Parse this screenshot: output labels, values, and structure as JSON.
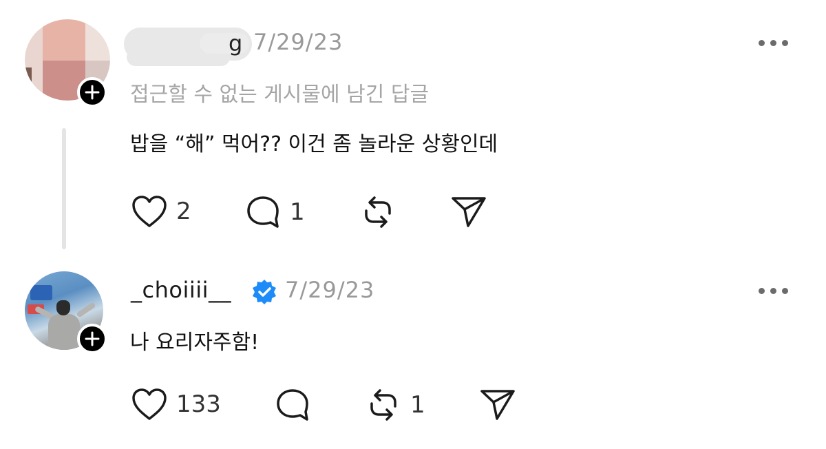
{
  "posts": [
    {
      "username_visible_tail": "g",
      "timestamp": "7/29/23",
      "subtitle": "접근할 수 없는 게시물에 남긴 답글",
      "text": "밥을 “해” 먹어?? 이건 좀 놀라운 상황인데",
      "likes": "2",
      "replies": "1",
      "reposts": "",
      "icons": [
        "heart-icon",
        "comment-icon",
        "repost-icon",
        "send-icon",
        "plus-icon",
        "more-icon"
      ]
    },
    {
      "username": "_choiiii__",
      "verified": true,
      "timestamp": "7/29/23",
      "text": "나 요리자주함!",
      "likes": "133",
      "replies": "",
      "reposts": "1",
      "icons": [
        "heart-icon",
        "comment-icon",
        "repost-icon",
        "send-icon",
        "plus-icon",
        "more-icon",
        "verified-badge-icon"
      ]
    }
  ],
  "colors": {
    "accent_verified": "#1d8cf8",
    "muted_text": "#999999",
    "thread_line": "#e4e4e4"
  }
}
